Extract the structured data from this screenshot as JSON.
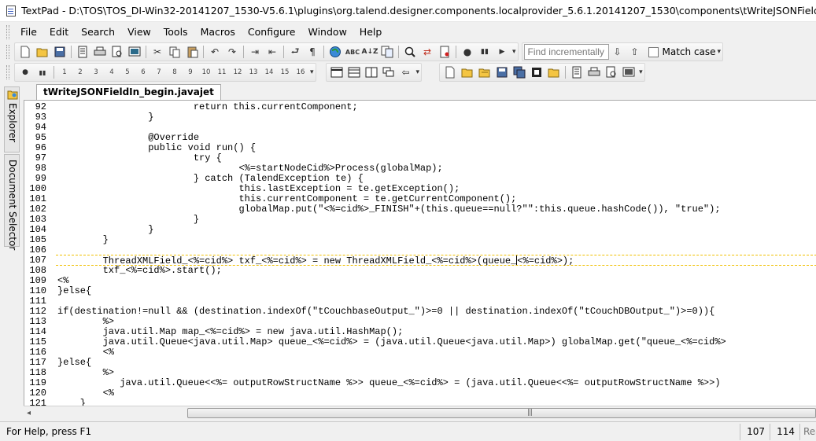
{
  "window": {
    "title": "TextPad - D:\\TOS\\TOS_DI-Win32-20141207_1530-V5.6.1\\plugins\\org.talend.designer.components.localprovider_5.6.1.20141207_1530\\components\\tWriteJSONFieldIn\\tWrite"
  },
  "menu": [
    "File",
    "Edit",
    "Search",
    "View",
    "Tools",
    "Macros",
    "Configure",
    "Window",
    "Help"
  ],
  "toolbar": {
    "find_placeholder": "Find incrementally",
    "match_case_label": "Match case"
  },
  "bookmarks": [
    "1",
    "2",
    "3",
    "4",
    "5",
    "6",
    "7",
    "8",
    "9",
    "10",
    "11",
    "12",
    "13",
    "14",
    "15",
    "16"
  ],
  "sidebar": {
    "explorer_label": "Explorer",
    "document_selector_label": "Document Selector"
  },
  "document": {
    "tab_label": "tWriteJSONFieldIn_begin.javajet",
    "current_line_number": "107",
    "lines": [
      {
        "n": "92",
        "text": "                        return this.currentComponent;"
      },
      {
        "n": "93",
        "text": "                }"
      },
      {
        "n": "94",
        "text": ""
      },
      {
        "n": "95",
        "text": "                @Override"
      },
      {
        "n": "96",
        "text": "                public void run() {"
      },
      {
        "n": "97",
        "text": "                        try {"
      },
      {
        "n": "98",
        "text": "                                <%=startNodeCid%>Process(globalMap);"
      },
      {
        "n": "99",
        "text": "                        } catch (TalendException te) {"
      },
      {
        "n": "100",
        "text": "                                this.lastException = te.getException();"
      },
      {
        "n": "101",
        "text": "                                this.currentComponent = te.getCurrentComponent();"
      },
      {
        "n": "102",
        "text": "                                globalMap.put(\"<%=cid%>_FINISH\"+(this.queue==null?\"\":this.queue.hashCode()), \"true\");"
      },
      {
        "n": "103",
        "text": "                        }"
      },
      {
        "n": "104",
        "text": "                }"
      },
      {
        "n": "105",
        "text": "        }"
      },
      {
        "n": "106",
        "text": ""
      },
      {
        "n": "107",
        "text": "        ThreadXMLField_<%=cid%> txf_<%=cid%> = new ThreadXMLField_<%=cid%>(queue_",
        "text_after_caret": "<%=cid%>);"
      },
      {
        "n": "108",
        "text": "        txf_<%=cid%>.start();"
      },
      {
        "n": "109",
        "text": "<%"
      },
      {
        "n": "110",
        "text": "}else{"
      },
      {
        "n": "111",
        "text": ""
      },
      {
        "n": "112",
        "text": "if(destination!=null && (destination.indexOf(\"tCouchbaseOutput_\")>=0 || destination.indexOf(\"tCouchDBOutput_\")>=0)){"
      },
      {
        "n": "113",
        "text": "        %>"
      },
      {
        "n": "114",
        "text": "        java.util.Map map_<%=cid%> = new java.util.HashMap();"
      },
      {
        "n": "115",
        "text": "        java.util.Queue<java.util.Map> queue_<%=cid%> = (java.util.Queue<java.util.Map>) globalMap.get(\"queue_<%=cid%>"
      },
      {
        "n": "116",
        "text": "        <%"
      },
      {
        "n": "117",
        "text": "}else{"
      },
      {
        "n": "118",
        "text": "        %>"
      },
      {
        "n": "119",
        "text": "           java.util.Queue<<%= outputRowStructName %>> queue_<%=cid%> = (java.util.Queue<<%= outputRowStructName %>>)"
      },
      {
        "n": "120",
        "text": "        <%"
      },
      {
        "n": "121",
        "text": "    }"
      }
    ]
  },
  "status": {
    "help": "For Help, press F1",
    "line": "107",
    "column": "114",
    "mode": "Read"
  },
  "icons": [
    "new-file-icon",
    "open-file-icon",
    "save-icon",
    "print-icon",
    "print-preview-icon",
    "cut-icon",
    "copy-icon",
    "paste-icon",
    "undo-icon",
    "redo-icon",
    "indent-icon",
    "outdent-icon",
    "word-wrap-icon",
    "paragraph-icon",
    "globe-icon",
    "spell-check-icon",
    "sort-icon",
    "find-icon",
    "bookmark-icon",
    "replace-icon",
    "record-icon",
    "play-icon",
    "find-next-icon",
    "find-previous-icon"
  ]
}
